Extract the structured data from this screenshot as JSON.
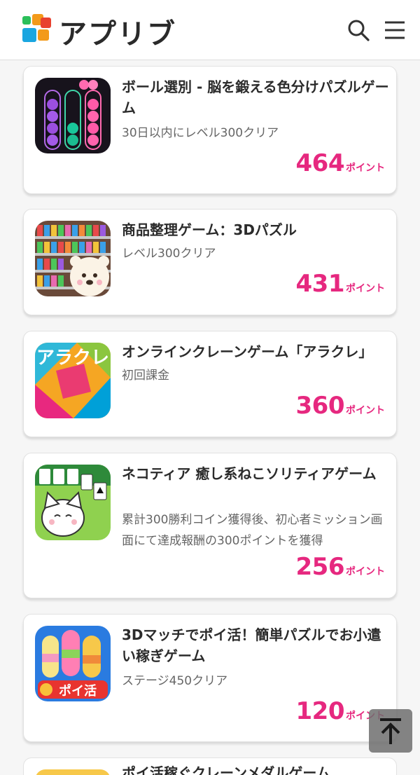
{
  "header": {
    "logo_text": "アプリブ",
    "search_icon": "search-icon",
    "menu_icon": "hamburger-menu-icon"
  },
  "colors": {
    "accent": "#e6287f",
    "logo_green": "#2bbf5a",
    "logo_orange": "#f39a1a",
    "logo_red": "#e8412f",
    "logo_blue": "#1aa6e0"
  },
  "offers": [
    {
      "title": "ボール選別 - 脳を鍛える色分けパズルゲーム",
      "condition": "30日以内にレベル300クリア",
      "points": "464",
      "unit": "ポイント"
    },
    {
      "title": "商品整理ゲーム：3Dパズル",
      "condition": "レベル300クリア",
      "points": "431",
      "unit": "ポイント"
    },
    {
      "title": "オンラインクレーンゲーム「アラクレ」",
      "condition": "初回課金",
      "points": "360",
      "unit": "ポイント",
      "icon_text": "アラクレ"
    },
    {
      "title": "ネコティア 癒し系ねこソリティアゲーム",
      "condition": "累計300勝利コイン獲得後、初心者ミッション画面にて達成報酬の300ポイントを獲得",
      "points": "256",
      "unit": "ポイント"
    },
    {
      "title": "3Dマッチでポイ活！簡単パズルでお小遣い稼ぎゲーム",
      "condition": "ステージ450クリア",
      "points": "120",
      "unit": "ポイント",
      "icon_text": "ポイ活"
    },
    {
      "title": "ポイ活稼ぐクレーンメダルゲーム"
    }
  ],
  "back_to_top_icon": "arrow-up-to-line-icon"
}
